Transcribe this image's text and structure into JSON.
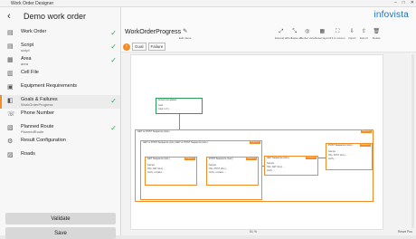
{
  "window": {
    "title": "Work Order Designer",
    "controls": [
      "–",
      "□",
      "✕"
    ]
  },
  "sidebar": {
    "back_glyph": "‹",
    "title": "Demo work order",
    "items": [
      {
        "label": "Work Order",
        "sub": "",
        "icon": "document-icon",
        "glyph": "▤",
        "done": true
      },
      {
        "label": "Script",
        "sub": "script",
        "icon": "script-icon",
        "glyph": "▤",
        "done": true
      },
      {
        "label": "Area",
        "sub": "area",
        "icon": "map-icon",
        "glyph": "▦",
        "done": true
      },
      {
        "label": "Cell File",
        "sub": "",
        "icon": "file-icon",
        "glyph": "▥",
        "done": false
      },
      {
        "label": "Equipment Requirements",
        "sub": "",
        "icon": "equipment-icon",
        "glyph": "▣",
        "done": false
      },
      {
        "label": "Goals & Failures",
        "sub": "WorkOrderProgress",
        "icon": "goals-icon",
        "glyph": "◧",
        "done": true,
        "active": true
      },
      {
        "label": "Phone Number",
        "sub": "",
        "icon": "phone-icon",
        "glyph": "☏",
        "done": false
      },
      {
        "label": "Planned Route",
        "sub": "PlannedRoute",
        "icon": "route-icon",
        "glyph": "▧",
        "done": true
      },
      {
        "label": "Result Configuration",
        "sub": "",
        "icon": "settings-icon",
        "glyph": "⚙",
        "done": false
      },
      {
        "label": "Roads",
        "sub": "",
        "icon": "road-icon",
        "glyph": "▨",
        "done": false
      }
    ],
    "check_glyph": "✓",
    "validate_label": "Validate",
    "save_label": "Save"
  },
  "main": {
    "brand": "infovista",
    "doc_title": "WorkOrderProgress",
    "toolbar": [
      {
        "label": "Edit name",
        "icon": "edit-icon",
        "glyph": "✎"
      },
      {
        "label": "Expand all",
        "icon": "expand-icon",
        "glyph": "⤢"
      },
      {
        "label": "Collapse all",
        "icon": "collapse-icon",
        "glyph": "⤡"
      },
      {
        "label": "Center view",
        "icon": "center-icon",
        "glyph": "◎"
      },
      {
        "label": "Reset layout",
        "icon": "layout-icon",
        "glyph": "▦"
      },
      {
        "label": "Fit to screen",
        "icon": "fit-icon",
        "glyph": "⛶"
      },
      {
        "label": "Import",
        "icon": "import-icon",
        "glyph": "⇩"
      },
      {
        "label": "Export",
        "icon": "export-icon",
        "glyph": "⇧"
      },
      {
        "label": "Delete",
        "icon": "delete-icon",
        "glyph": "🗑"
      }
    ],
    "filter_icon_glyph": "!",
    "chips": [
      "Goal",
      "Failure"
    ],
    "zoom": "51 %",
    "reset_label": "Reset Pos"
  },
  "diagram": {
    "nodes": [
      {
        "title": "Group completed",
        "body": [
          "Goal",
          "Goal 1 of 1 ..."
        ]
      },
      {
        "title": "GET or POST Sequence (ALL)",
        "badge": "Sequence"
      },
      {
        "title": "GET or POST Sequence (ALL) GET or POST Sequence (ALL)",
        "badge": "Sequence"
      },
      {
        "title": "GET Sequence (ALL)",
        "badge": "Sequence",
        "body": [
          "Sample",
          "Http: GET (ALL) ...",
          "Verify: contains ..."
        ]
      },
      {
        "title": "POST Sequence (ALL)",
        "badge": "Sequence",
        "body": [
          "Sample",
          "Http: POST (ALL) ...",
          "Verify: contains ..."
        ]
      },
      {
        "title": "GET Sequence (ALL)",
        "badge": "Sequence",
        "body": [
          "Sample",
          "Http: GET (ALL) ...",
          "Verify: ..."
        ]
      },
      {
        "title": "POST Sequence (ALL)",
        "badge": "Sequence",
        "body": [
          "Sample",
          "Http: POST (ALL) ...",
          "Verify: ..."
        ]
      }
    ]
  }
}
